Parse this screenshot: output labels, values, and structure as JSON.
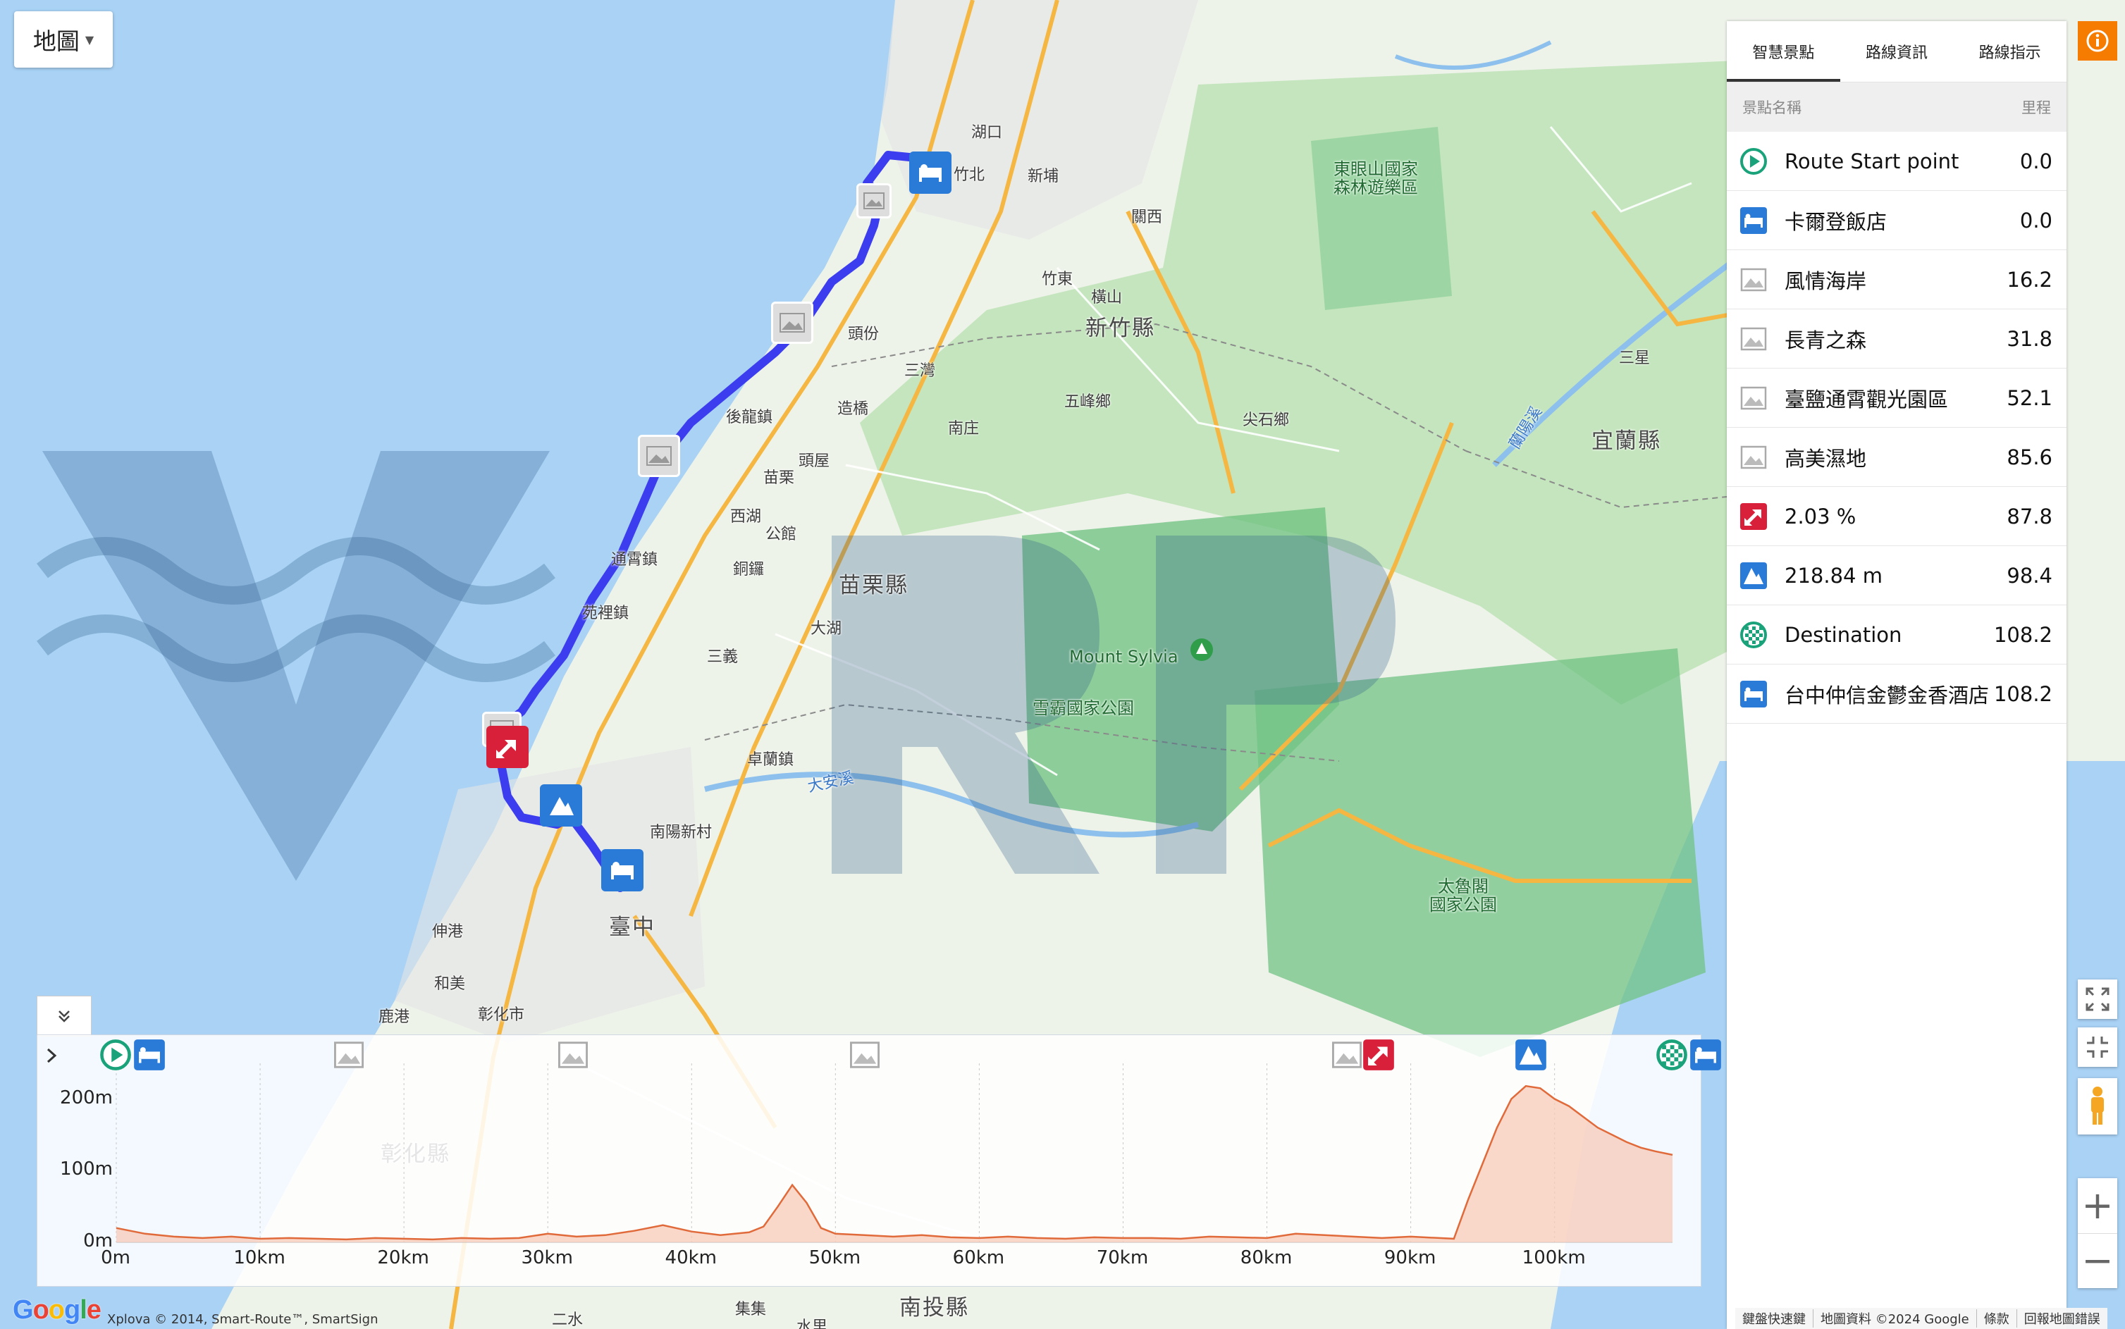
{
  "map": {
    "type_button": "地圖",
    "labels": [
      {
        "text": "湖口",
        "cls": ""
      },
      {
        "text": "竹北",
        "cls": ""
      },
      {
        "text": "新埔",
        "cls": ""
      },
      {
        "text": "關西",
        "cls": ""
      },
      {
        "text": "竹東",
        "cls": ""
      },
      {
        "text": "橫山",
        "cls": ""
      },
      {
        "text": "頭份",
        "cls": ""
      },
      {
        "text": "三灣",
        "cls": ""
      },
      {
        "text": "新竹縣",
        "cls": "big"
      },
      {
        "text": "五峰鄉",
        "cls": ""
      },
      {
        "text": "尖石鄉",
        "cls": ""
      },
      {
        "text": "後龍鎮",
        "cls": ""
      },
      {
        "text": "造橋",
        "cls": ""
      },
      {
        "text": "南庄",
        "cls": ""
      },
      {
        "text": "頭屋",
        "cls": ""
      },
      {
        "text": "苗栗",
        "cls": ""
      },
      {
        "text": "西湖",
        "cls": ""
      },
      {
        "text": "公館",
        "cls": ""
      },
      {
        "text": "銅鑼",
        "cls": ""
      },
      {
        "text": "通霄鎮",
        "cls": ""
      },
      {
        "text": "苗栗縣",
        "cls": "big"
      },
      {
        "text": "苑裡鎮",
        "cls": ""
      },
      {
        "text": "大湖",
        "cls": ""
      },
      {
        "text": "三義",
        "cls": ""
      },
      {
        "text": "卓蘭鎮",
        "cls": ""
      },
      {
        "text": "大安溪",
        "cls": "blue"
      },
      {
        "text": "南陽新村",
        "cls": ""
      },
      {
        "text": "臺中",
        "cls": "big"
      },
      {
        "text": "伸港",
        "cls": ""
      },
      {
        "text": "和美",
        "cls": ""
      },
      {
        "text": "鹿港",
        "cls": ""
      },
      {
        "text": "彰化市",
        "cls": ""
      },
      {
        "text": "東眼山國家",
        "cls": "park"
      },
      {
        "text": "森林遊樂區",
        "cls": "park"
      },
      {
        "text": "Mount Sylvia",
        "cls": "park"
      },
      {
        "text": "雪霸國家公園",
        "cls": "park"
      },
      {
        "text": "三星",
        "cls": ""
      },
      {
        "text": "宜蘭縣",
        "cls": "big"
      },
      {
        "text": "太魯閣",
        "cls": "park"
      },
      {
        "text": "國家公園",
        "cls": "park"
      },
      {
        "text": "南投縣",
        "cls": "big"
      },
      {
        "text": "二水",
        "cls": ""
      },
      {
        "text": "集集",
        "cls": ""
      },
      {
        "text": "水里",
        "cls": ""
      },
      {
        "text": "彰化縣",
        "cls": "big"
      },
      {
        "text": "蘭陽溪",
        "cls": "blue"
      }
    ]
  },
  "panel": {
    "tabs": [
      "智慧景點",
      "路線資訊",
      "路線指示"
    ],
    "active_tab": 0,
    "header": {
      "name": "景點名稱",
      "distance": "里程"
    },
    "poi": [
      {
        "name": "Route Start point",
        "dist": "0.0",
        "icon": "start-icon"
      },
      {
        "name": "卡爾登飯店",
        "dist": "0.0",
        "icon": "hotel-icon"
      },
      {
        "name": "風情海岸",
        "dist": "16.2",
        "icon": "photo-icon"
      },
      {
        "name": "長青之森",
        "dist": "31.8",
        "icon": "photo-icon"
      },
      {
        "name": "臺鹽通霄觀光園區",
        "dist": "52.1",
        "icon": "photo-icon"
      },
      {
        "name": "高美濕地",
        "dist": "85.6",
        "icon": "photo-icon"
      },
      {
        "name": "2.03 %",
        "dist": "87.8",
        "icon": "grade-icon"
      },
      {
        "name": "218.84 m",
        "dist": "98.4",
        "icon": "peak-icon"
      },
      {
        "name": "Destination",
        "dist": "108.2",
        "icon": "destination-icon"
      },
      {
        "name": "台中仲信金鬱金香酒店",
        "dist": "108.2",
        "icon": "hotel-icon"
      }
    ]
  },
  "elevation": {
    "y_ticks": [
      "200m",
      "100m",
      "0m"
    ],
    "x_ticks": [
      "0m",
      "10km",
      "20km",
      "30km",
      "40km",
      "50km",
      "60km",
      "70km",
      "80km",
      "90km",
      "100km"
    ]
  },
  "chart_data": {
    "type": "area",
    "xlabel": "",
    "ylabel": "",
    "x": [
      0,
      2,
      4,
      6,
      8,
      10,
      12,
      14,
      16,
      18,
      20,
      22,
      24,
      26,
      28,
      30,
      32,
      34,
      36,
      38,
      40,
      42,
      44,
      45,
      46,
      47,
      48,
      49,
      50,
      52,
      54,
      56,
      58,
      60,
      62,
      64,
      66,
      68,
      70,
      72,
      74,
      76,
      78,
      80,
      82,
      84,
      86,
      88,
      90,
      92,
      93,
      94,
      95,
      96,
      97,
      98,
      99,
      100,
      101,
      102,
      103,
      104,
      105,
      106,
      107,
      108.2
    ],
    "y": [
      20,
      12,
      8,
      6,
      8,
      5,
      6,
      5,
      4,
      6,
      5,
      4,
      6,
      5,
      6,
      12,
      8,
      10,
      16,
      24,
      15,
      10,
      14,
      22,
      50,
      80,
      55,
      20,
      12,
      10,
      8,
      10,
      7,
      6,
      8,
      6,
      5,
      7,
      6,
      6,
      5,
      8,
      7,
      6,
      12,
      10,
      8,
      6,
      8,
      6,
      5,
      60,
      110,
      160,
      200,
      218,
      215,
      200,
      190,
      175,
      160,
      150,
      140,
      132,
      127,
      122
    ],
    "ylim": [
      0,
      230
    ],
    "xlim": [
      0,
      108.2
    ],
    "line_color": "#e06a3a",
    "fill_color": "#f7c9b8",
    "icons": [
      {
        "dist": 0.0,
        "icon": "start-icon"
      },
      {
        "dist": 0.0,
        "icon": "hotel-icon"
      },
      {
        "dist": 16.2,
        "icon": "photo-icon"
      },
      {
        "dist": 31.8,
        "icon": "photo-icon"
      },
      {
        "dist": 52.1,
        "icon": "photo-icon"
      },
      {
        "dist": 85.6,
        "icon": "photo-icon"
      },
      {
        "dist": 87.8,
        "icon": "grade-icon"
      },
      {
        "dist": 98.4,
        "icon": "peak-icon"
      },
      {
        "dist": 108.2,
        "icon": "destination-icon"
      },
      {
        "dist": 108.2,
        "icon": "hotel-icon"
      }
    ]
  },
  "footer": {
    "google": "Google",
    "credit_left": "Xplova © 2014, Smart-Route™, SmartSign",
    "credit_right": [
      "鍵盤快速鍵",
      "地圖資料 ©2024 Google",
      "條款",
      "回報地圖錯誤"
    ]
  },
  "colors": {
    "route": "#3d3df0",
    "water": "#a9d2f5",
    "land": "#e8f0e4",
    "forest": "#79c98a",
    "accent": "#f57c00"
  }
}
